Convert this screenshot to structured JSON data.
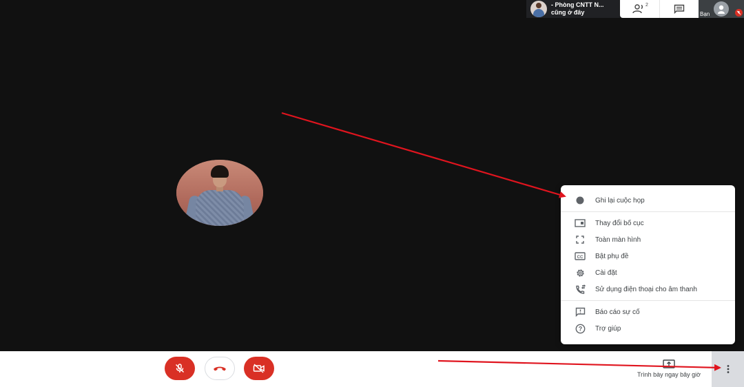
{
  "topbar": {
    "room_name": "- Phòng CNTT N...",
    "room_status": "cũng ở đây",
    "people_count": "2",
    "self_label": "Bạn"
  },
  "menu": {
    "items": [
      {
        "icon": "record-dot-icon",
        "label": "Ghi lại cuộc họp"
      },
      {
        "icon": "layout-icon",
        "label": "Thay đổi bố cục"
      },
      {
        "icon": "fullscreen-icon",
        "label": "Toàn màn hình"
      },
      {
        "icon": "captions-icon",
        "label": "Bật phụ đề"
      },
      {
        "icon": "gear-icon",
        "label": "Cài đặt"
      },
      {
        "icon": "phone-audio-icon",
        "label": "Sử dụng điện thoại cho âm thanh"
      },
      {
        "icon": "report-icon",
        "label": "Báo cáo sự cố"
      },
      {
        "icon": "help-icon",
        "label": "Trợ giúp"
      }
    ]
  },
  "bottombar": {
    "present_label": "Trình bày ngay bây giờ"
  },
  "colors": {
    "background": "#111111",
    "danger": "#d93025",
    "annotation": "#e0141e"
  }
}
